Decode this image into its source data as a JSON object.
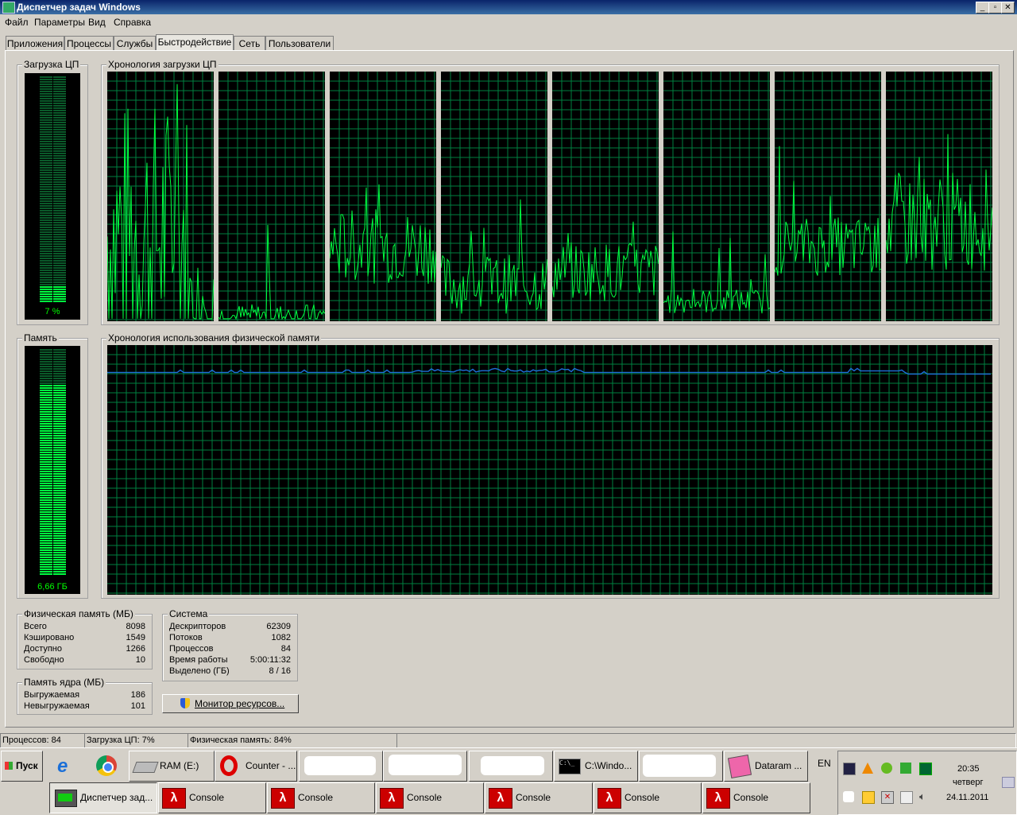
{
  "window": {
    "title": "Диспетчер задач Windows"
  },
  "menu": [
    "Файл",
    "Параметры",
    "Вид",
    "Справка"
  ],
  "tabs": [
    "Приложения",
    "Процессы",
    "Службы",
    "Быстродействие",
    "Сеть",
    "Пользователи"
  ],
  "cpu": {
    "group_label": "Загрузка ЦП",
    "value_label": "7 %",
    "level": 0.07
  },
  "cpu_history": {
    "group_label": "Хронология загрузки ЦП"
  },
  "memory": {
    "group_label": "Память",
    "value_label": "6,66 ГБ",
    "level": 0.84
  },
  "memory_history": {
    "group_label": "Хронология использования физической памяти",
    "line_color": "#1e6fd9"
  },
  "physical_memory": {
    "label": "Физическая память (МБ)",
    "rows": [
      [
        "Всего",
        "8098"
      ],
      [
        "Кэшировано",
        "1549"
      ],
      [
        "Доступно",
        "1266"
      ],
      [
        "Свободно",
        "10"
      ]
    ]
  },
  "kernel_memory": {
    "label": "Память ядра (МБ)",
    "rows": [
      [
        "Выгружаемая",
        "186"
      ],
      [
        "Невыгружаемая",
        "101"
      ]
    ]
  },
  "system": {
    "label": "Система",
    "rows": [
      [
        "Дескрипторов",
        "62309"
      ],
      [
        "Потоков",
        "1082"
      ],
      [
        "Процессов",
        "84"
      ],
      [
        "Время работы",
        "5:00:11:32"
      ],
      [
        "Выделено (ГБ)",
        "8 / 16"
      ]
    ]
  },
  "resource_monitor_button": "Монитор ресурсов...",
  "status": {
    "processes": "Процессов: 84",
    "cpu": "Загрузка ЦП: 7%",
    "memory": "Физическая память: 84%"
  },
  "taskbar": {
    "start": "Пуск",
    "row1": [
      "RAM (E:)",
      "Counter - ...",
      "C:\\Windo...",
      "Dataram ..."
    ],
    "row2": [
      "Диспетчер зад...",
      "Console",
      "Console",
      "Console",
      "Console",
      "Console",
      "Console"
    ],
    "lang": "EN",
    "time": "20:35",
    "day": "четверг",
    "date": "24.11.2011"
  },
  "colors": {
    "graph_green": "#00ff40",
    "grid": "#008040",
    "mem_line": "#1e6fd9"
  }
}
